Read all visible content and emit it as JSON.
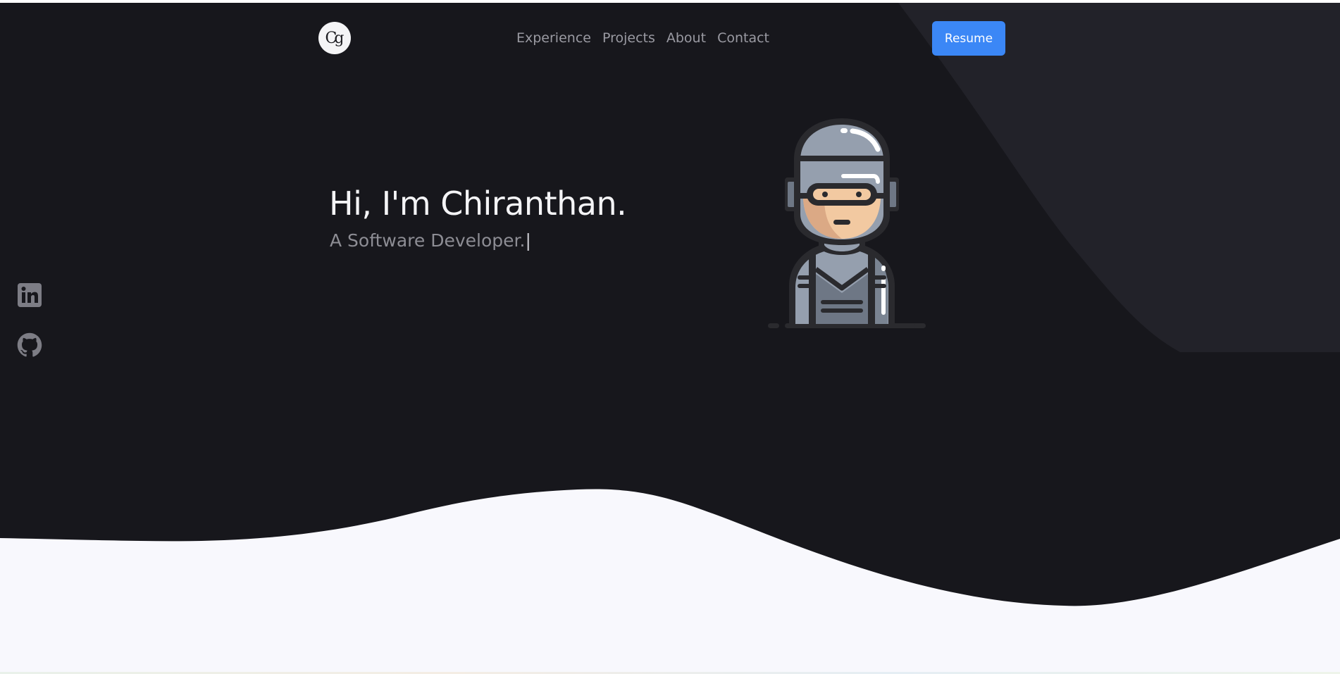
{
  "brand": {
    "logo_text": "Cg",
    "logo_icon": "monogram-logo"
  },
  "nav": {
    "links": [
      "Experience",
      "Projects",
      "About",
      "Contact"
    ],
    "resume_label": "Resume"
  },
  "hero": {
    "greeting": "Hi, I'm Chiranthan.",
    "subtitle": "A Software Developer.",
    "cursor": "|"
  },
  "social": [
    {
      "name": "linkedin-icon"
    },
    {
      "name": "github-icon"
    }
  ],
  "colors": {
    "background_dark": "#17171c",
    "accent_panel": "#222229",
    "wave_light": "#f8f8fd",
    "button_blue": "#3b87f6",
    "text_primary": "#f4f4f6",
    "text_muted": "#8d8d94"
  }
}
